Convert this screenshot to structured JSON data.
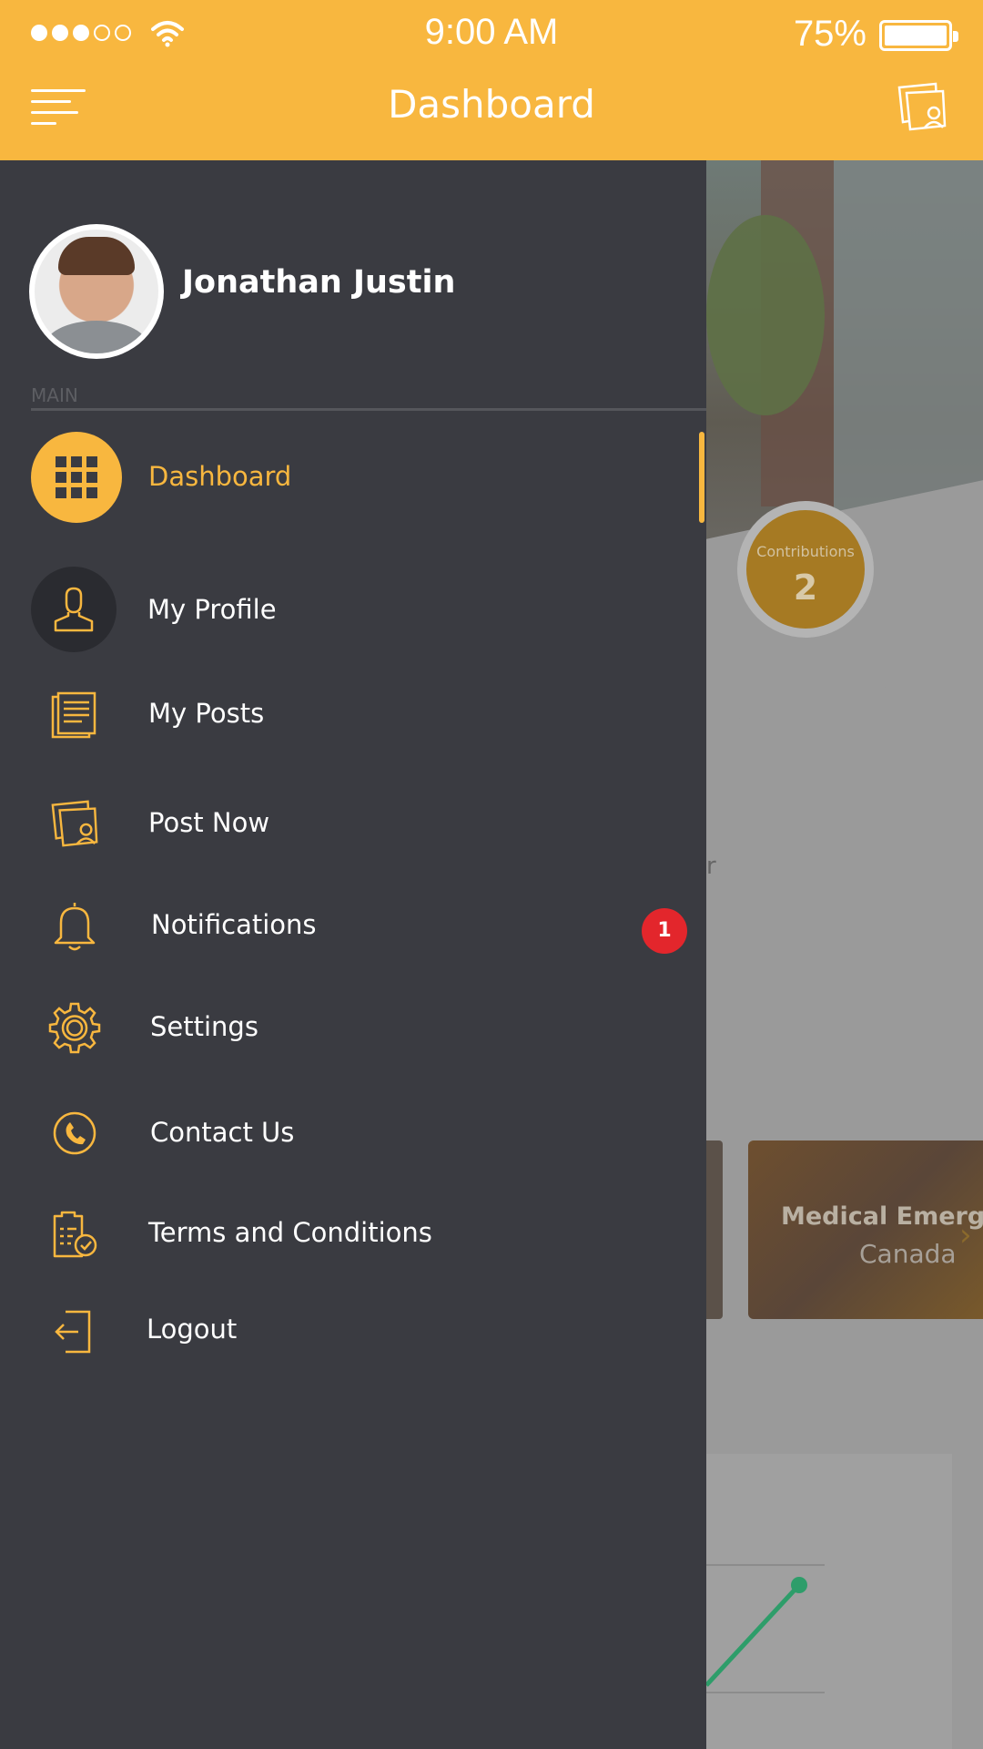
{
  "status_bar": {
    "time": "9:00 AM",
    "battery": "75%",
    "signal_bars_filled": 3,
    "signal_bars_total": 5
  },
  "header": {
    "title": "Dashboard",
    "menu_icon": "hamburger-menu-icon",
    "action_icon": "post-now-icon"
  },
  "user": {
    "name": "Jonathan Justin"
  },
  "drawer": {
    "section_label": "MAIN",
    "items": [
      {
        "label": "Dashboard",
        "icon": "grid-icon",
        "active": true
      },
      {
        "label": "My Profile",
        "icon": "user-icon"
      },
      {
        "label": "My Posts",
        "icon": "posts-icon"
      },
      {
        "label": "Post Now",
        "icon": "post-now-icon"
      },
      {
        "label": "Notifications",
        "icon": "bell-icon",
        "badge": "1"
      },
      {
        "label": "Settings",
        "icon": "gear-icon"
      },
      {
        "label": "Contact Us",
        "icon": "phone-icon"
      },
      {
        "label": "Terms and Conditions",
        "icon": "document-check-icon"
      },
      {
        "label": "Logout",
        "icon": "logout-icon"
      }
    ]
  },
  "background": {
    "contributions_label": "Contributions",
    "contributions_value": "2",
    "partial_text": "r",
    "card_title": "Medical Emerge",
    "card_subtitle": "Canada"
  },
  "colors": {
    "accent": "#f8b73f",
    "drawer_bg": "#3a3b41",
    "badge": "#e3262c",
    "chart_line": "#2e9d6a"
  }
}
